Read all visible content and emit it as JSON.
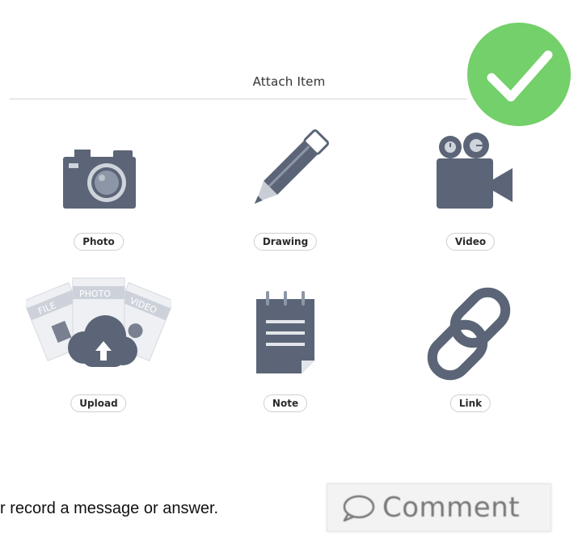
{
  "header": {
    "title": "Attach Item"
  },
  "attach_options": [
    {
      "label": "Photo",
      "icon": "camera-icon"
    },
    {
      "label": "Drawing",
      "icon": "pencil-icon"
    },
    {
      "label": "Video",
      "icon": "video-camera-icon"
    },
    {
      "label": "Upload",
      "icon": "upload-cloud-icon",
      "card_labels": [
        "FILE",
        "PHOTO",
        "VIDEO"
      ]
    },
    {
      "label": "Note",
      "icon": "notepad-icon"
    },
    {
      "label": "Link",
      "icon": "chain-link-icon"
    }
  ],
  "instruction": {
    "text": "r record a message or answer."
  },
  "comment_button": {
    "label": "Comment",
    "icon": "speech-bubble-icon"
  },
  "colors": {
    "icon": "#5b6577",
    "check_badge": "#74d06a",
    "pill_border": "#cfcfcf",
    "divider": "#d4d4d4"
  }
}
